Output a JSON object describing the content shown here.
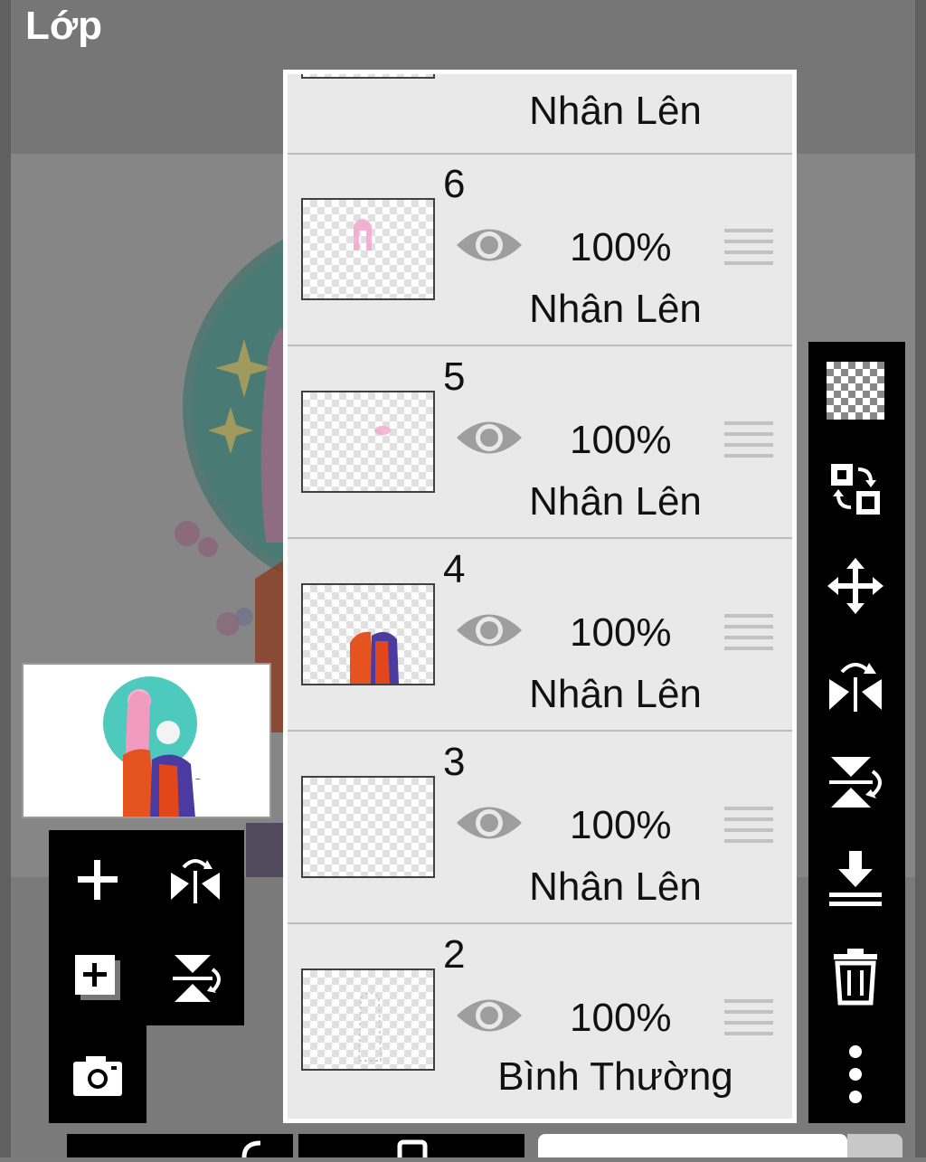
{
  "header": {
    "title": "Lớp"
  },
  "layers": [
    {
      "number": "",
      "opacity": "",
      "blend_mode": "Nhân Lên"
    },
    {
      "number": "6",
      "opacity": "100%",
      "blend_mode": "Nhân Lên"
    },
    {
      "number": "5",
      "opacity": "100%",
      "blend_mode": "Nhân Lên"
    },
    {
      "number": "4",
      "opacity": "100%",
      "blend_mode": "Nhân Lên"
    },
    {
      "number": "3",
      "opacity": "100%",
      "blend_mode": "Nhân Lên"
    },
    {
      "number": "2",
      "opacity": "100%",
      "blend_mode": "Bình Thường"
    }
  ],
  "left_tools": [
    "add-layer",
    "flip-horizontal",
    "add-layer-copy",
    "flip-vertical",
    "camera"
  ],
  "right_tools": [
    "transparency",
    "swap-layers",
    "move",
    "flip-horizontal",
    "flip-vertical",
    "merge-down",
    "delete",
    "more"
  ],
  "colors": {
    "panel_bg": "#e9e9e9",
    "toolbar": "#000000",
    "teal": "#3fb5a5",
    "pink": "#f0a0c8",
    "orange": "#e05a1e",
    "purple": "#4b3aa0"
  }
}
